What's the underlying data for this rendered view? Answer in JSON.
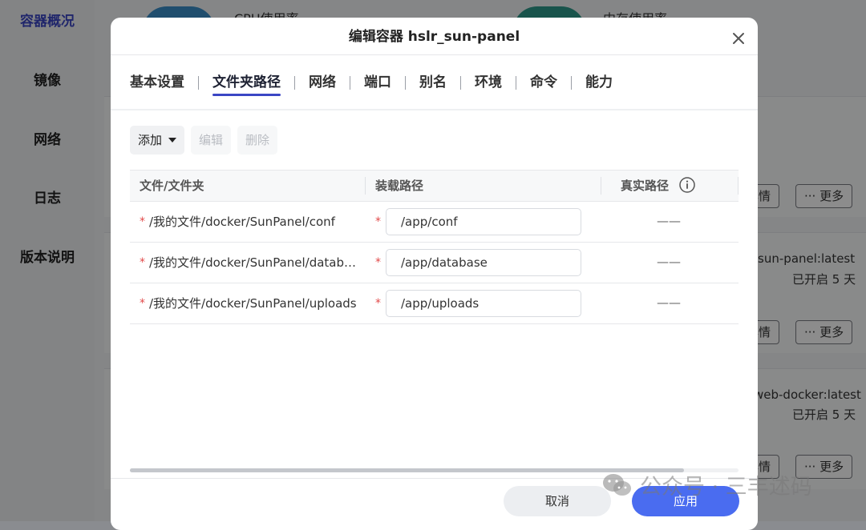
{
  "background": {
    "sidebar": [
      {
        "label": "容器概况",
        "active": true
      },
      {
        "label": "镜像"
      },
      {
        "label": "网络"
      },
      {
        "label": "日志"
      },
      {
        "label": "版本说明"
      }
    ],
    "stats": {
      "cpu_label": "CPU使用率",
      "mem_label": "内存使用率"
    },
    "cards": [
      {
        "details": "详情",
        "more": "··· 更多"
      },
      {
        "image": "/sun-panel:latest",
        "uptime": "已开启 5 天",
        "details": "详情",
        "more": "··· 更多"
      },
      {
        "image": "web-docker:latest",
        "uptime": "已开启 5 天",
        "details": "详情",
        "more": "··· 更多"
      }
    ]
  },
  "modal": {
    "title": "编辑容器 hslr_sun-panel",
    "tabs": [
      "基本设置",
      "文件夹路径",
      "网络",
      "端口",
      "别名",
      "环境",
      "命令",
      "能力"
    ],
    "active_tab": 1,
    "toolbar": {
      "add": "添加",
      "edit": "编辑",
      "delete": "删除"
    },
    "table": {
      "headers": {
        "host": "文件/文件夹",
        "mount": "装载路径",
        "real": "真实路径"
      },
      "rows": [
        {
          "host": "/我的文件/docker/SunPanel/conf",
          "mount": "/app/conf",
          "real": "——"
        },
        {
          "host": "/我的文件/docker/SunPanel/database",
          "mount": "/app/database",
          "real": "——"
        },
        {
          "host": "/我的文件/docker/SunPanel/uploads",
          "mount": "/app/uploads",
          "real": "——"
        }
      ],
      "required_mark": "*"
    },
    "footer": {
      "cancel": "取消",
      "apply": "应用"
    }
  },
  "watermark": "公众号 · 三丰述码",
  "colors": {
    "accent": "#3b46c4",
    "primary_button": "#4a6cf0",
    "required": "#e24a4a"
  }
}
